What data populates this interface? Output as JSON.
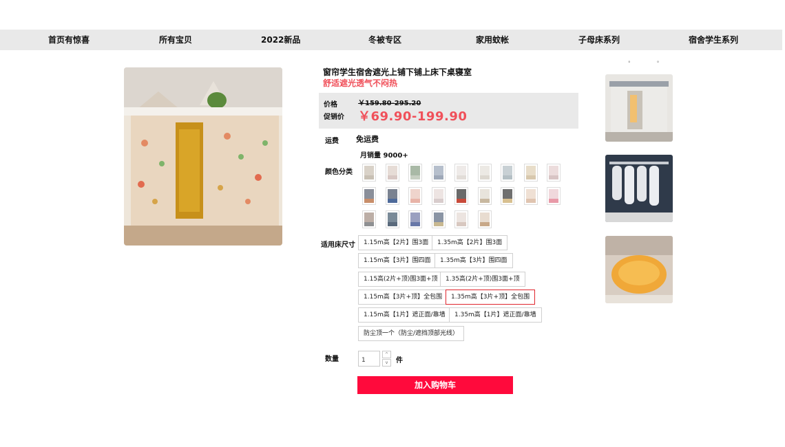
{
  "nav": {
    "items": [
      "首页有惊喜",
      "所有宝贝",
      "2022新品",
      "冬被专区",
      "家用蚊帐",
      "子母床系列",
      "宿舍学生系列"
    ]
  },
  "product": {
    "title": "窗帘学生宿舍遮光上铺下铺上床下桌寝室",
    "subtitle": "舒适遮光透气不闷热"
  },
  "price": {
    "original_label": "价格",
    "original_value": "￥159.80-295.20",
    "promo_label": "促销价",
    "promo_value": "￥69.90-199.90"
  },
  "shipping": {
    "label": "运费",
    "value": "免运费"
  },
  "sales": {
    "text": "月销量  9000+"
  },
  "color": {
    "label": "颜色分类",
    "swatches": [
      {
        "top": "#d9d2c8",
        "bottom": "#c8c0b4"
      },
      {
        "top": "#e6dcd6",
        "bottom": "#d8c8c4"
      },
      {
        "top": "#a9b9a6",
        "bottom": "#c7cfc2"
      },
      {
        "top": "#b6bfcc",
        "bottom": "#9ea8b8"
      },
      {
        "top": "#eeeae8",
        "bottom": "#e2ddd8"
      },
      {
        "top": "#ece9e4",
        "bottom": "#ddd8d0"
      },
      {
        "top": "#c8d0d4",
        "bottom": "#b4bfc4"
      },
      {
        "top": "#e8ddc9",
        "bottom": "#d8c8ad"
      },
      {
        "top": "#ecdcdc",
        "bottom": "#d8c4c4"
      },
      {
        "top": "#8a8f9a",
        "bottom": "#c88e6a"
      },
      {
        "top": "#7a8290",
        "bottom": "#4e6a9a"
      },
      {
        "top": "#efd4cc",
        "bottom": "#e8b4a8"
      },
      {
        "top": "#ede4e2",
        "bottom": "#d8cccc"
      },
      {
        "top": "#6a6a6a",
        "bottom": "#c84a3a"
      },
      {
        "top": "#e8e4dc",
        "bottom": "#c8b8a0"
      },
      {
        "top": "#6f6f6f",
        "bottom": "#d8c090"
      },
      {
        "top": "#efe0d4",
        "bottom": "#e0c4b0"
      },
      {
        "top": "#f0d8dc",
        "bottom": "#e89aa8"
      },
      {
        "top": "#bcaea6",
        "bottom": "#8e9092"
      },
      {
        "top": "#7a8a98",
        "bottom": "#5a6a7c"
      },
      {
        "top": "#9aa0c0",
        "bottom": "#6878a8"
      },
      {
        "top": "#8a94a4",
        "bottom": "#c8b890"
      },
      {
        "top": "#ece4e0",
        "bottom": "#d8c8c0"
      },
      {
        "top": "#e8dcd0",
        "bottom": "#c8a888"
      }
    ]
  },
  "size": {
    "label": "适用床尺寸",
    "options": [
      "1.15m高【2片】围3面",
      "1.35m高【2片】围3面",
      "1.15m高【3片】围四面",
      "1.35m高【3片】围四面",
      "1.15高(2片+顶)围3面+顶",
      "1.35高(2片+顶)围3面+顶",
      "1.15m高【3片+顶】全包围",
      "1.35m高【3片+顶】全包围",
      "1.15m高【1片】遮正面/靠墙",
      "1.35m高【1片】遮正面/靠墙",
      "防尘顶一个（防尘/遮挡顶部光线）"
    ],
    "selected_index": 7
  },
  "quantity": {
    "label": "数量",
    "value": "1",
    "up": "^",
    "down": "v",
    "unit": "件"
  },
  "cart": {
    "label": "加入购物车"
  },
  "thumbs": {
    "dots": "° °"
  }
}
